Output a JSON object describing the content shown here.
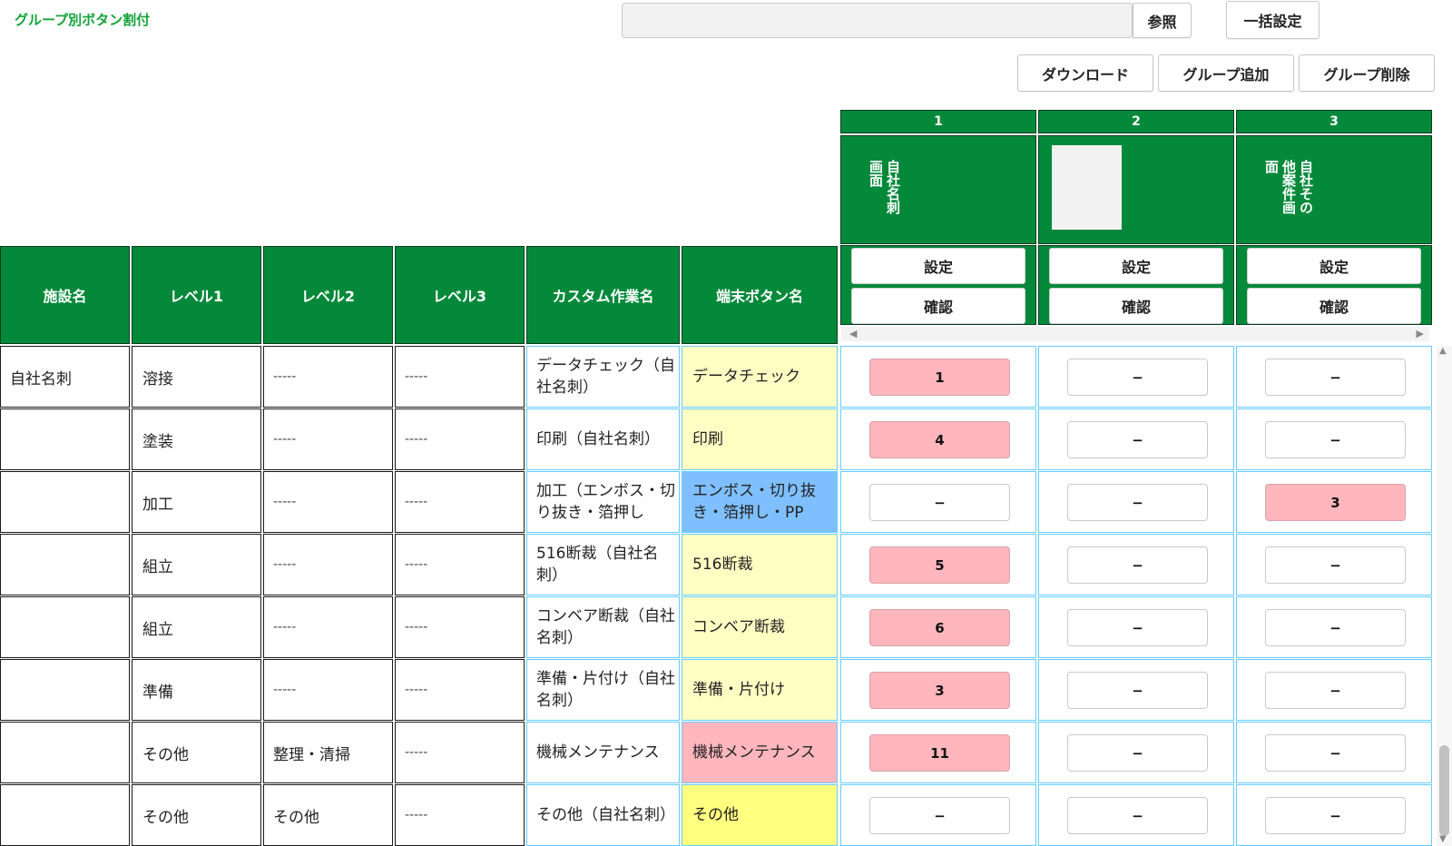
{
  "title": "グループ別ボタン割付",
  "toolbar": {
    "browse": "参照",
    "bulk_set": "一括設定",
    "download": "ダウンロード",
    "add_group": "グループ追加",
    "delete_group": "グループ削除"
  },
  "columns": {
    "facility": "施設名",
    "level1": "レベル1",
    "level2": "レベル2",
    "level3": "レベル3",
    "custom_task": "カスタム作業名",
    "terminal_button": "端末ボタン名"
  },
  "groups": [
    {
      "number": "1",
      "name": "自社名刺\n画面",
      "has_image": false,
      "setting": "設定",
      "confirm": "確認"
    },
    {
      "number": "2",
      "name": "",
      "has_image": true,
      "setting": "設定",
      "confirm": "確認"
    },
    {
      "number": "3",
      "name": "自社その\n他案件画\n面",
      "has_image": false,
      "setting": "設定",
      "confirm": "確認"
    }
  ],
  "rows": [
    {
      "facility": "自社名刺",
      "level1": "溶接",
      "level2": "-----",
      "level3": "-----",
      "custom_task": "データチェック（自社名刺）",
      "button_name": "データチェック",
      "button_color": "#ffffc4",
      "assign": [
        "1",
        "−",
        "−"
      ]
    },
    {
      "facility": "",
      "level1": "塗装",
      "level2": "-----",
      "level3": "-----",
      "custom_task": "印刷（自社名刺）",
      "button_name": "印刷",
      "button_color": "#ffffc4",
      "assign": [
        "4",
        "−",
        "−"
      ]
    },
    {
      "facility": "",
      "level1": "加工",
      "level2": "-----",
      "level3": "-----",
      "custom_task": "加工（エンボス・切り抜き・箔押し",
      "button_name": "エンボス・切り抜き・箔押し・PP",
      "button_color": "#7fbfff",
      "assign": [
        "−",
        "−",
        "3"
      ]
    },
    {
      "facility": "",
      "level1": "組立",
      "level2": "-----",
      "level3": "-----",
      "custom_task": "516断裁（自社名刺）",
      "button_name": "516断裁",
      "button_color": "#ffffc4",
      "assign": [
        "5",
        "−",
        "−"
      ]
    },
    {
      "facility": "",
      "level1": "組立",
      "level2": "-----",
      "level3": "-----",
      "custom_task": "コンベア断裁（自社名刺）",
      "button_name": "コンベア断裁",
      "button_color": "#ffffc4",
      "assign": [
        "6",
        "−",
        "−"
      ]
    },
    {
      "facility": "",
      "level1": "準備",
      "level2": "-----",
      "level3": "-----",
      "custom_task": "準備・片付け（自社名刺）",
      "button_name": "準備・片付け",
      "button_color": "#ffffc4",
      "assign": [
        "3",
        "−",
        "−"
      ]
    },
    {
      "facility": "",
      "level1": "その他",
      "level2": "整理・清掃",
      "level3": "-----",
      "custom_task": "機械メンテナンス",
      "button_name": "機械メンテナンス",
      "button_color": "#ffb6bd",
      "assign": [
        "11",
        "−",
        "−"
      ]
    },
    {
      "facility": "",
      "level1": "その他",
      "level2": "その他",
      "level3": "-----",
      "custom_task": "その他（自社名刺）",
      "button_name": "その他",
      "button_color": "#ffff80",
      "assign": [
        "−",
        "−",
        "−"
      ]
    }
  ],
  "colors": {
    "header_green": "#04893a",
    "title_green": "#13a33a",
    "assigned_pink": "#ffb6bd",
    "cell_border_blue": "#66ccff"
  }
}
